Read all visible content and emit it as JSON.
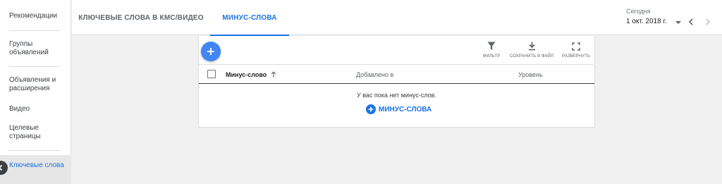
{
  "sidebar": {
    "items": [
      {
        "label": "Рекомендации"
      },
      {
        "label": "Группы объявлений"
      },
      {
        "label": "Объявления и расширения"
      },
      {
        "label": "Видео"
      },
      {
        "label": "Целевые страницы"
      },
      {
        "label": "Ключевые слова"
      }
    ],
    "active_index": 5
  },
  "tabs": [
    {
      "label": "КЛЮЧЕВЫЕ СЛОВА В КМС/ВИДЕО"
    },
    {
      "label": "МИНУС-СЛОВА"
    }
  ],
  "active_tab": 1,
  "date": {
    "label": "Сегодня",
    "value": "1 окт. 2018 г."
  },
  "toolbar": {
    "filter_label": "ФИЛЬТР",
    "save_label": "СОХРАНИТЬ В ФАЙЛ",
    "expand_label": "РАЗВЕРНУТЬ"
  },
  "table": {
    "columns": [
      "Минус-слово",
      "Добавлено в",
      "Уровень"
    ],
    "empty_text": "У вас пока нет минус-слов.",
    "add_label": "МИНУС-СЛОВА"
  },
  "colors": {
    "accent": "#1a73e8",
    "fab": "#4285f4"
  },
  "icons": [
    "plus-icon",
    "filter-icon",
    "download-icon",
    "fullscreen-icon",
    "sort-up-icon",
    "chevron-left-icon",
    "chevron-right-icon",
    "caret-down-icon",
    "plus-circle-icon"
  ]
}
